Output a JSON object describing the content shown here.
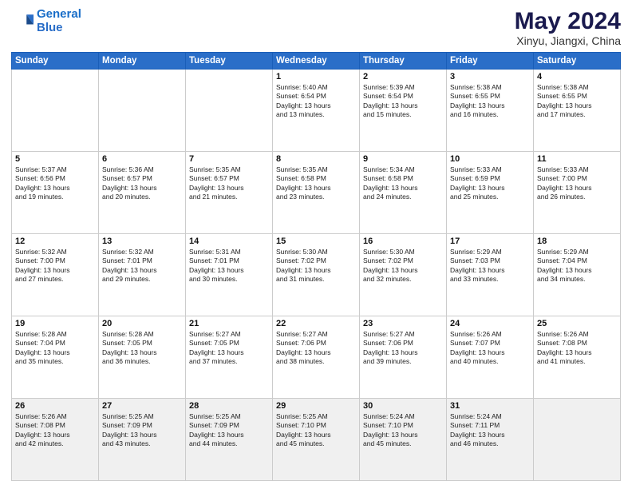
{
  "header": {
    "logo_line1": "General",
    "logo_line2": "Blue",
    "main_title": "May 2024",
    "subtitle": "Xinyu, Jiangxi, China"
  },
  "days_of_week": [
    "Sunday",
    "Monday",
    "Tuesday",
    "Wednesday",
    "Thursday",
    "Friday",
    "Saturday"
  ],
  "weeks": [
    [
      {
        "day": "",
        "info": ""
      },
      {
        "day": "",
        "info": ""
      },
      {
        "day": "",
        "info": ""
      },
      {
        "day": "1",
        "info": "Sunrise: 5:40 AM\nSunset: 6:54 PM\nDaylight: 13 hours\nand 13 minutes."
      },
      {
        "day": "2",
        "info": "Sunrise: 5:39 AM\nSunset: 6:54 PM\nDaylight: 13 hours\nand 15 minutes."
      },
      {
        "day": "3",
        "info": "Sunrise: 5:38 AM\nSunset: 6:55 PM\nDaylight: 13 hours\nand 16 minutes."
      },
      {
        "day": "4",
        "info": "Sunrise: 5:38 AM\nSunset: 6:55 PM\nDaylight: 13 hours\nand 17 minutes."
      }
    ],
    [
      {
        "day": "5",
        "info": "Sunrise: 5:37 AM\nSunset: 6:56 PM\nDaylight: 13 hours\nand 19 minutes."
      },
      {
        "day": "6",
        "info": "Sunrise: 5:36 AM\nSunset: 6:57 PM\nDaylight: 13 hours\nand 20 minutes."
      },
      {
        "day": "7",
        "info": "Sunrise: 5:35 AM\nSunset: 6:57 PM\nDaylight: 13 hours\nand 21 minutes."
      },
      {
        "day": "8",
        "info": "Sunrise: 5:35 AM\nSunset: 6:58 PM\nDaylight: 13 hours\nand 23 minutes."
      },
      {
        "day": "9",
        "info": "Sunrise: 5:34 AM\nSunset: 6:58 PM\nDaylight: 13 hours\nand 24 minutes."
      },
      {
        "day": "10",
        "info": "Sunrise: 5:33 AM\nSunset: 6:59 PM\nDaylight: 13 hours\nand 25 minutes."
      },
      {
        "day": "11",
        "info": "Sunrise: 5:33 AM\nSunset: 7:00 PM\nDaylight: 13 hours\nand 26 minutes."
      }
    ],
    [
      {
        "day": "12",
        "info": "Sunrise: 5:32 AM\nSunset: 7:00 PM\nDaylight: 13 hours\nand 27 minutes."
      },
      {
        "day": "13",
        "info": "Sunrise: 5:32 AM\nSunset: 7:01 PM\nDaylight: 13 hours\nand 29 minutes."
      },
      {
        "day": "14",
        "info": "Sunrise: 5:31 AM\nSunset: 7:01 PM\nDaylight: 13 hours\nand 30 minutes."
      },
      {
        "day": "15",
        "info": "Sunrise: 5:30 AM\nSunset: 7:02 PM\nDaylight: 13 hours\nand 31 minutes."
      },
      {
        "day": "16",
        "info": "Sunrise: 5:30 AM\nSunset: 7:02 PM\nDaylight: 13 hours\nand 32 minutes."
      },
      {
        "day": "17",
        "info": "Sunrise: 5:29 AM\nSunset: 7:03 PM\nDaylight: 13 hours\nand 33 minutes."
      },
      {
        "day": "18",
        "info": "Sunrise: 5:29 AM\nSunset: 7:04 PM\nDaylight: 13 hours\nand 34 minutes."
      }
    ],
    [
      {
        "day": "19",
        "info": "Sunrise: 5:28 AM\nSunset: 7:04 PM\nDaylight: 13 hours\nand 35 minutes."
      },
      {
        "day": "20",
        "info": "Sunrise: 5:28 AM\nSunset: 7:05 PM\nDaylight: 13 hours\nand 36 minutes."
      },
      {
        "day": "21",
        "info": "Sunrise: 5:27 AM\nSunset: 7:05 PM\nDaylight: 13 hours\nand 37 minutes."
      },
      {
        "day": "22",
        "info": "Sunrise: 5:27 AM\nSunset: 7:06 PM\nDaylight: 13 hours\nand 38 minutes."
      },
      {
        "day": "23",
        "info": "Sunrise: 5:27 AM\nSunset: 7:06 PM\nDaylight: 13 hours\nand 39 minutes."
      },
      {
        "day": "24",
        "info": "Sunrise: 5:26 AM\nSunset: 7:07 PM\nDaylight: 13 hours\nand 40 minutes."
      },
      {
        "day": "25",
        "info": "Sunrise: 5:26 AM\nSunset: 7:08 PM\nDaylight: 13 hours\nand 41 minutes."
      }
    ],
    [
      {
        "day": "26",
        "info": "Sunrise: 5:26 AM\nSunset: 7:08 PM\nDaylight: 13 hours\nand 42 minutes."
      },
      {
        "day": "27",
        "info": "Sunrise: 5:25 AM\nSunset: 7:09 PM\nDaylight: 13 hours\nand 43 minutes."
      },
      {
        "day": "28",
        "info": "Sunrise: 5:25 AM\nSunset: 7:09 PM\nDaylight: 13 hours\nand 44 minutes."
      },
      {
        "day": "29",
        "info": "Sunrise: 5:25 AM\nSunset: 7:10 PM\nDaylight: 13 hours\nand 45 minutes."
      },
      {
        "day": "30",
        "info": "Sunrise: 5:24 AM\nSunset: 7:10 PM\nDaylight: 13 hours\nand 45 minutes."
      },
      {
        "day": "31",
        "info": "Sunrise: 5:24 AM\nSunset: 7:11 PM\nDaylight: 13 hours\nand 46 minutes."
      },
      {
        "day": "",
        "info": ""
      }
    ]
  ]
}
